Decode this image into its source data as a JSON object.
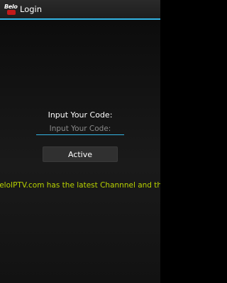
{
  "action_bar": {
    "logo_text": "Belo",
    "title": "Login",
    "accent_color": "#33b5e5"
  },
  "form": {
    "prompt": "Input Your Code:",
    "code_placeholder": "Input Your Code:",
    "code_value": "",
    "submit_label": "Active"
  },
  "ticker": {
    "text": "BeloIPTV.com has the latest Channnel and the",
    "color": "#b8d200"
  }
}
